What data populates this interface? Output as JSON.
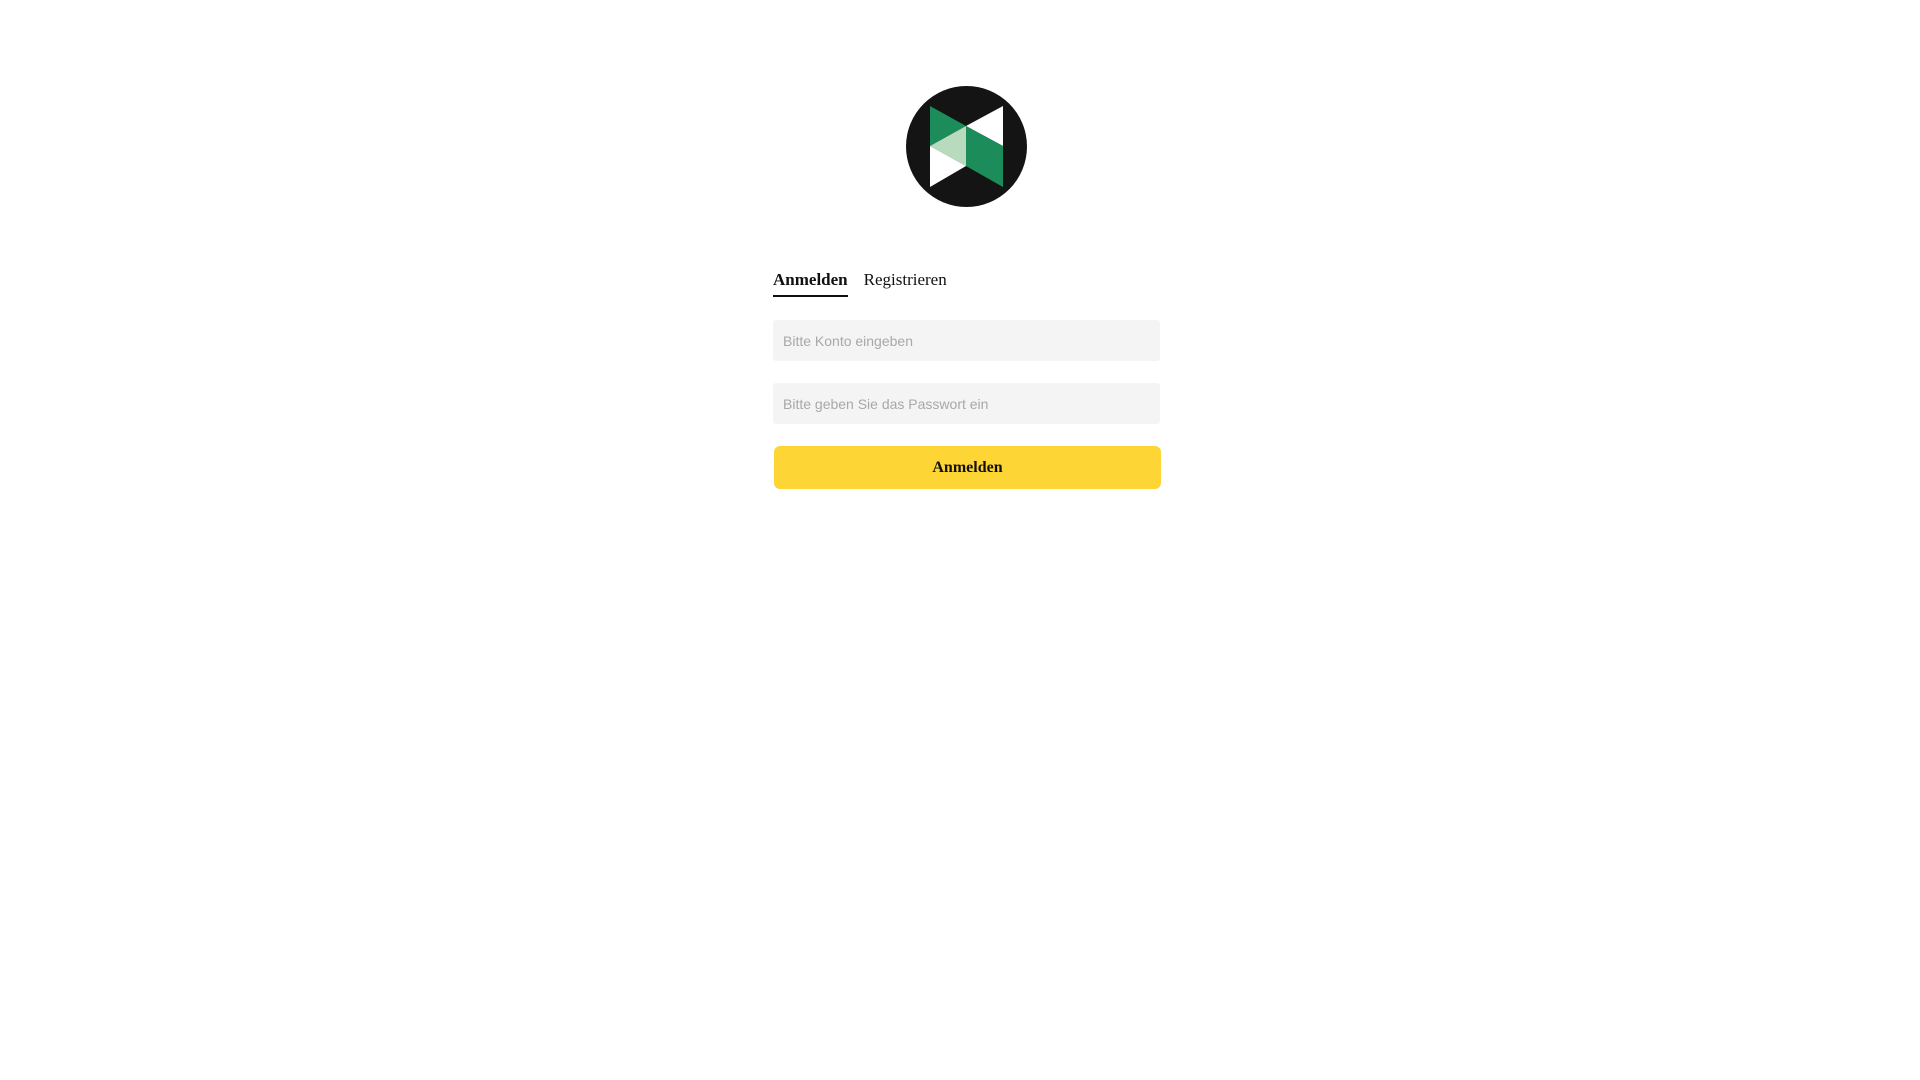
{
  "brand": {
    "logo_icon": "bowtie-logo-icon",
    "circle_color": "#141414",
    "green_dark": "#1b8c5a",
    "green_light": "#b9dbbd",
    "white": "#ffffff"
  },
  "tabs": [
    {
      "label": "Anmelden",
      "active": true
    },
    {
      "label": "Registrieren",
      "active": false
    }
  ],
  "form": {
    "account_placeholder": "Bitte Konto eingeben",
    "account_value": "",
    "password_placeholder": "Bitte geben Sie das Passwort ein",
    "password_value": "",
    "submit_label": "Anmelden"
  },
  "colors": {
    "accent": "#fdd535",
    "input_bg": "#f4f4f4",
    "placeholder": "#a8a8a8"
  }
}
